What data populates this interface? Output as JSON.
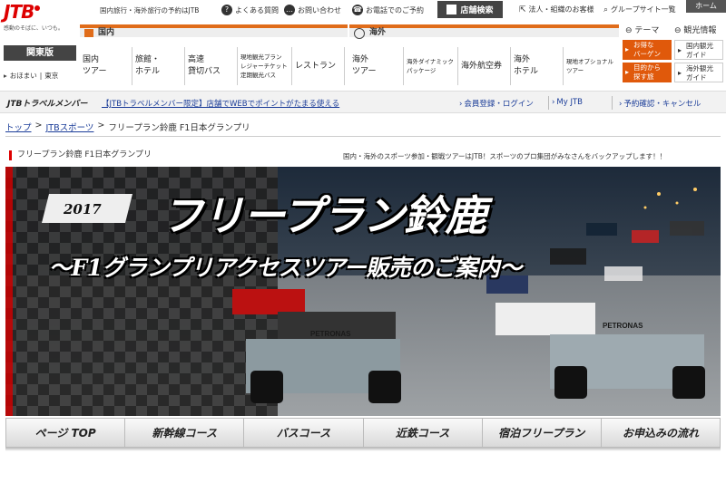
{
  "header": {
    "logo_text": "JTB",
    "logo_tagline": "感動のそばに、いつも。",
    "top_note": "国内旅行・海外旅行の予約はJTB",
    "faq": "よくある質問",
    "contact": "お問い合わせ",
    "phone_booking": "お電話でのご予約",
    "store_search": "店舗検索",
    "corporate": "法人・組織のお客様",
    "group_site": "グループサイト一覧",
    "home": "ホーム"
  },
  "region": {
    "label": "関東版",
    "home_label": "おほまい",
    "city": "東京"
  },
  "tabs": {
    "domestic": "国内",
    "international": "海外",
    "theme": "テーマ",
    "guide": "観光情報"
  },
  "domestic_nav": [
    {
      "label": "国内\nツアー"
    },
    {
      "label": "旅館・\nホテル"
    },
    {
      "label": "高速\n貸切バス"
    },
    {
      "label": "現地観光プラン\nレジャーチケット\n定期観光バス"
    },
    {
      "label": "レストラン"
    }
  ],
  "international_nav": [
    {
      "label": "海外\nツアー"
    },
    {
      "label": "海外ダイナミック\nパッケージ"
    },
    {
      "label": "海外航空券"
    },
    {
      "label": "海外\nホテル"
    },
    {
      "label": "現地オプショナル\nツアー"
    }
  ],
  "side_nav": [
    {
      "label": "お得な\nバーゲン"
    },
    {
      "label": "国内観光\nガイド"
    },
    {
      "label": "目的から\n探す旅"
    },
    {
      "label": "海外観光\nガイド"
    }
  ],
  "member_bar": {
    "logo": "JTBトラベルメンバー",
    "promo": "【JTBトラベルメンバー限定】店舗でWEBでポイントがたまる使える",
    "register_login": "会員登録・ログイン",
    "my_jtb": "My JTB",
    "reservation": "予約確認・キャンセル"
  },
  "breadcrumb": {
    "top": "トップ",
    "sports": "JTBスポーツ",
    "current": "フリープラン鈴鹿 F1日本グランプリ"
  },
  "page": {
    "heading": "フリープラン鈴鹿 F1日本グランプリ",
    "description": "国内・海外のスポーツ参加・観戦ツアーはJTB！スポーツのプロ集団がみなさんをバックアップします！！"
  },
  "hero": {
    "year": "2017",
    "title": "フリープラン鈴鹿",
    "subtitle": "～F1グランプリアクセスツアー販売のご案内～",
    "car_livery": "PETRONAS"
  },
  "bottom_nav": [
    {
      "label": "ページ TOP"
    },
    {
      "label": "新幹線コース"
    },
    {
      "label": "バスコース"
    },
    {
      "label": "近鉄コース"
    },
    {
      "label": "宿泊フリープラン"
    },
    {
      "label": "お申込みの流れ"
    }
  ],
  "colors": {
    "brand_red": "#dd0000",
    "accent_orange": "#e0590b",
    "link_blue": "#1a3c98"
  }
}
